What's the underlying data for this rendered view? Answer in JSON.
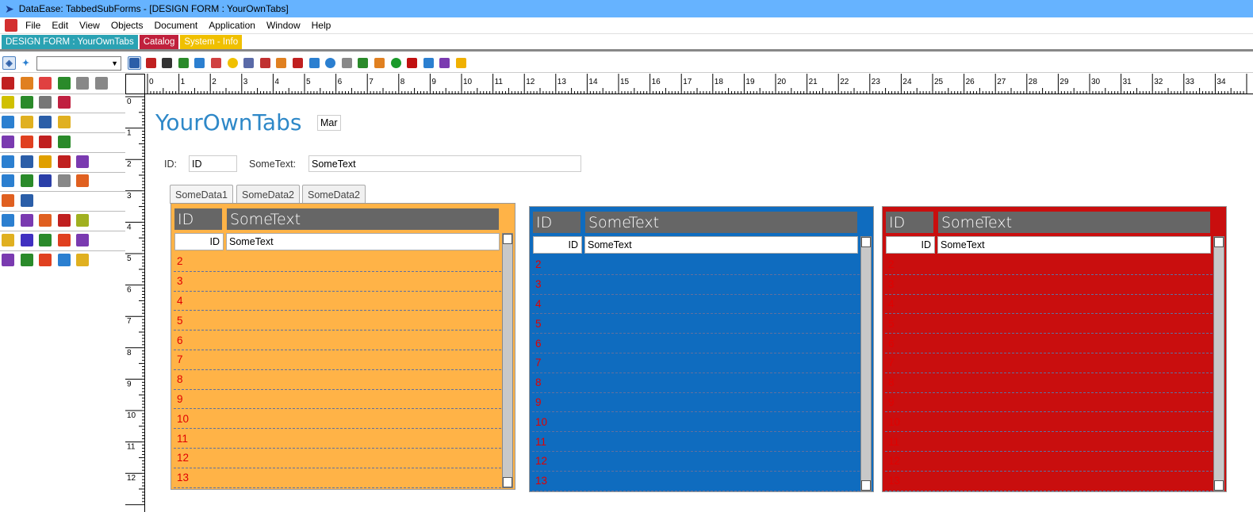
{
  "window": {
    "title": "DataEase: TabbedSubForms - [DESIGN FORM : YourOwnTabs]"
  },
  "menu": [
    "File",
    "Edit",
    "View",
    "Objects",
    "Document",
    "Application",
    "Window",
    "Help"
  ],
  "doc_tabs": [
    {
      "label": "DESIGN FORM : YourOwnTabs",
      "color": "#2aa2b3"
    },
    {
      "label": "Catalog",
      "color": "#c0203c"
    },
    {
      "label": "System - Info",
      "color": "#f0c000"
    }
  ],
  "ruler": {
    "h_ticks": [
      "0",
      "1",
      "2",
      "3",
      "4",
      "5",
      "6",
      "7",
      "8",
      "9",
      "10",
      "11",
      "12",
      "13",
      "14",
      "15",
      "16",
      "17",
      "18",
      "19",
      "20",
      "21",
      "22",
      "23",
      "24",
      "25",
      "26",
      "27",
      "28",
      "29",
      "30",
      "31",
      "32",
      "33",
      "34"
    ],
    "v_ticks": [
      "0",
      "1",
      "2",
      "3",
      "4",
      "5",
      "6",
      "7",
      "8",
      "9",
      "10",
      "11",
      "12"
    ]
  },
  "form": {
    "title": "YourOwnTabs",
    "mar_box": "Mar",
    "id_label": "ID:",
    "id_value": "ID",
    "sometext_label": "SomeText:",
    "sometext_value": "SomeText"
  },
  "subtabs": [
    "SomeData1",
    "SomeData2",
    "SomeData2"
  ],
  "panels": [
    {
      "color": "#ffb347",
      "hdr_id": "ID",
      "hdr_text": "SomeText",
      "row_id": "ID",
      "row_text": "SomeText",
      "rows": [
        "2",
        "3",
        "4",
        "5",
        "6",
        "7",
        "8",
        "9",
        "10",
        "11",
        "12",
        "13"
      ]
    },
    {
      "color": "#0f6cbf",
      "hdr_id": "ID",
      "hdr_text": "SomeText",
      "row_id": "ID",
      "row_text": "SomeText",
      "rows": [
        "2",
        "3",
        "4",
        "5",
        "6",
        "7",
        "8",
        "9",
        "10",
        "11",
        "12",
        "13"
      ]
    },
    {
      "color": "#c90e0e",
      "hdr_id": "ID",
      "hdr_text": "SomeText",
      "row_id": "ID",
      "row_text": "SomeText",
      "rows": [
        "2",
        "3",
        "4",
        "5",
        "6",
        "7",
        "8",
        "9",
        "10",
        "11",
        "12",
        "13"
      ]
    }
  ],
  "toolbar_icons": [
    "pointer-icon",
    "text-icon",
    "rectangle-icon",
    "web-icon",
    "checkbox-icon",
    "list-icon",
    "radio-icon",
    "grid-icon",
    "image-icon",
    "picture-icon",
    "www-icon",
    "button-icon",
    "oval-button-icon",
    "box-icon",
    "tree-icon",
    "line-icon",
    "ellipse-icon",
    "shape-icon",
    "chart-icon",
    "xml-icon",
    "note-icon"
  ],
  "colors": {
    "titlebar": "#66b3ff",
    "form_title": "#2e88c8",
    "row_number": "#e00000"
  }
}
